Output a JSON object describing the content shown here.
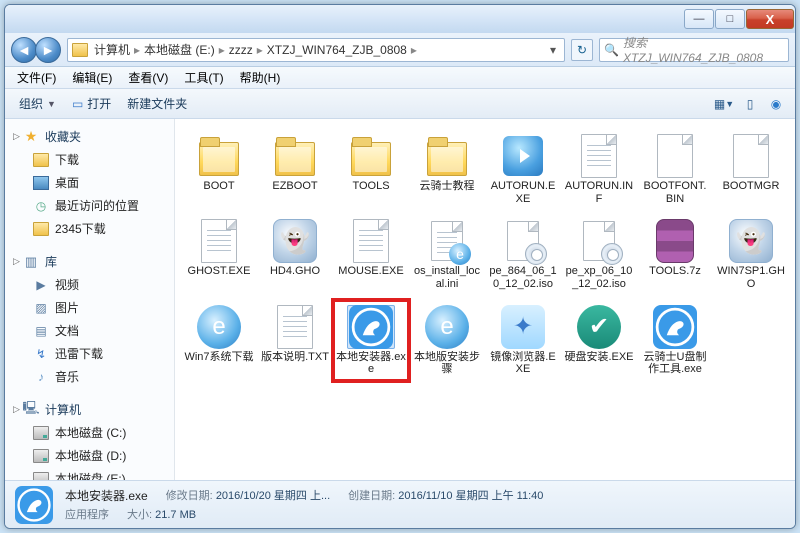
{
  "titlebar": {
    "min": "—",
    "max": "□",
    "close": "X"
  },
  "breadcrumb": {
    "root": "计算机",
    "parts": [
      "本地磁盘 (E:)",
      "zzzz",
      "XTZJ_WIN764_ZJB_0808"
    ]
  },
  "search": {
    "placeholder": "搜索 XTZJ_WIN764_ZJB_0808",
    "icon": "🔍"
  },
  "menu": {
    "file": "文件(F)",
    "edit": "编辑(E)",
    "view": "查看(V)",
    "tools": "工具(T)",
    "help": "帮助(H)"
  },
  "toolbar": {
    "organize": "组织",
    "open": "打开",
    "newfolder": "新建文件夹"
  },
  "sidebar": {
    "favorites": {
      "label": "收藏夹",
      "items": [
        {
          "label": "下载",
          "icon": "folder"
        },
        {
          "label": "桌面",
          "icon": "desk"
        },
        {
          "label": "最近访问的位置",
          "icon": "recent"
        },
        {
          "label": "2345下载",
          "icon": "folder"
        }
      ]
    },
    "libraries": {
      "label": "库",
      "items": [
        {
          "label": "视频",
          "icon": "video"
        },
        {
          "label": "图片",
          "icon": "pic"
        },
        {
          "label": "文档",
          "icon": "doc"
        },
        {
          "label": "迅雷下载",
          "icon": "thunder"
        },
        {
          "label": "音乐",
          "icon": "music"
        }
      ]
    },
    "computer": {
      "label": "计算机",
      "items": [
        {
          "label": "本地磁盘 (C:)",
          "icon": "drive"
        },
        {
          "label": "本地磁盘 (D:)",
          "icon": "drive"
        },
        {
          "label": "本地磁盘 (E:)",
          "icon": "drive"
        }
      ]
    }
  },
  "files": [
    {
      "name": "BOOT",
      "type": "folder"
    },
    {
      "name": "EZBOOT",
      "type": "folder"
    },
    {
      "name": "TOOLS",
      "type": "folder"
    },
    {
      "name": "云骑士教程",
      "type": "folder"
    },
    {
      "name": "AUTORUN.EXE",
      "type": "autorun"
    },
    {
      "name": "AUTORUN.INF",
      "type": "file-lines"
    },
    {
      "name": "BOOTFONT.BIN",
      "type": "file"
    },
    {
      "name": "BOOTMGR",
      "type": "file"
    },
    {
      "name": "GHOST.EXE",
      "type": "file-lines"
    },
    {
      "name": "HD4.GHO",
      "type": "ghost"
    },
    {
      "name": "MOUSE.EXE",
      "type": "file-lines"
    },
    {
      "name": "os_install_local.ini",
      "type": "file-lines-ie"
    },
    {
      "name": "pe_864_06_10_12_02.iso",
      "type": "disc"
    },
    {
      "name": "pe_xp_06_10_12_02.iso",
      "type": "disc"
    },
    {
      "name": "TOOLS.7z",
      "type": "rar"
    },
    {
      "name": "WIN7SP1.GHO",
      "type": "ghost"
    },
    {
      "name": "Win7系统下载",
      "type": "ie"
    },
    {
      "name": "版本说明.TXT",
      "type": "file-lines"
    },
    {
      "name": "本地安装器.exe",
      "type": "knight",
      "highlight": true
    },
    {
      "name": "本地版安装步骤",
      "type": "ie"
    },
    {
      "name": "镜像浏览器.EXE",
      "type": "shield"
    },
    {
      "name": "硬盘安装.EXE",
      "type": "teal"
    },
    {
      "name": "云骑士U盘制作工具.exe",
      "type": "knight"
    }
  ],
  "status": {
    "filename": "本地安装器.exe",
    "filetype": "应用程序",
    "mod_label": "修改日期:",
    "mod_value": "2016/10/20 星期四 上...",
    "size_label": "大小:",
    "size_value": "21.7 MB",
    "create_label": "创建日期:",
    "create_value": "2016/11/10 星期四 上午 11:40"
  }
}
